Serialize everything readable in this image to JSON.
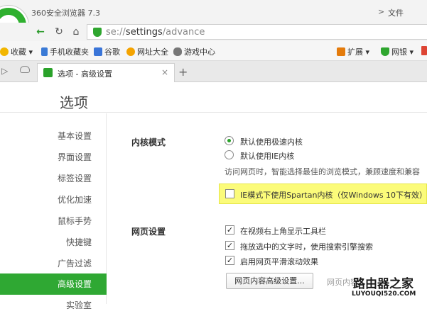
{
  "window": {
    "app_title": "360安全浏览器 7.3",
    "menu_file": "文件",
    "menu_chevron": ">"
  },
  "nav": {
    "url_scheme": "se://",
    "url_host": "settings",
    "url_path": "/advance"
  },
  "favorites": [
    {
      "label": "收藏",
      "icon": "star-icon",
      "color": "#f2b600"
    },
    {
      "label": "手机收藏夹",
      "icon": "phone-icon",
      "color": "#3b7bd6"
    },
    {
      "label": "谷歌",
      "icon": "google-icon",
      "color": "#3a75d8"
    },
    {
      "label": "网址大全",
      "icon": "globe-icon",
      "color": "#f4a300"
    },
    {
      "label": "游戏中心",
      "icon": "gamepad-icon",
      "color": "#777777"
    }
  ],
  "extensions": [
    {
      "label": "扩展",
      "icon": "grid-icon",
      "color": "#e47b0b"
    },
    {
      "label": "网银",
      "icon": "bank-shield-icon",
      "color": "#2fa62f"
    }
  ],
  "tab": {
    "label": "选项 - 高级设置",
    "close": "×",
    "new_tab": "+"
  },
  "page": {
    "title": "选项"
  },
  "sidebar": {
    "items": [
      "基本设置",
      "界面设置",
      "标签设置",
      "优化加速",
      "鼠标手势",
      "快捷键",
      "广告过滤",
      "高级设置",
      "实验室"
    ],
    "active_index": 7
  },
  "kernel": {
    "heading": "内核模式",
    "options": [
      {
        "label": "默认使用极速内核",
        "selected": true
      },
      {
        "label": "默认使用IE内核",
        "selected": false
      }
    ],
    "description": "访问网页时，智能选择最佳的浏览模式，兼顾速度和兼容",
    "spartan_label": "IE模式下使用Spartan内核（仅Windows 10下有效）",
    "spartan_checked": false
  },
  "webpage": {
    "heading": "网页设置",
    "options": [
      {
        "label": "在视频右上角显示工具栏",
        "checked": true
      },
      {
        "label": "拖放选中的文字时，使用搜索引擎搜索",
        "checked": true
      },
      {
        "label": "启用网页平滑滚动效果",
        "checked": true
      }
    ],
    "advanced_button": "网页内容高级设置...",
    "advanced_note": "网页内容"
  },
  "watermark": {
    "line1": "路由器之家",
    "line2": "LUYOUQI520.COM"
  },
  "colors": {
    "accent": "#2fa833",
    "highlight": "#fbfb7a"
  }
}
